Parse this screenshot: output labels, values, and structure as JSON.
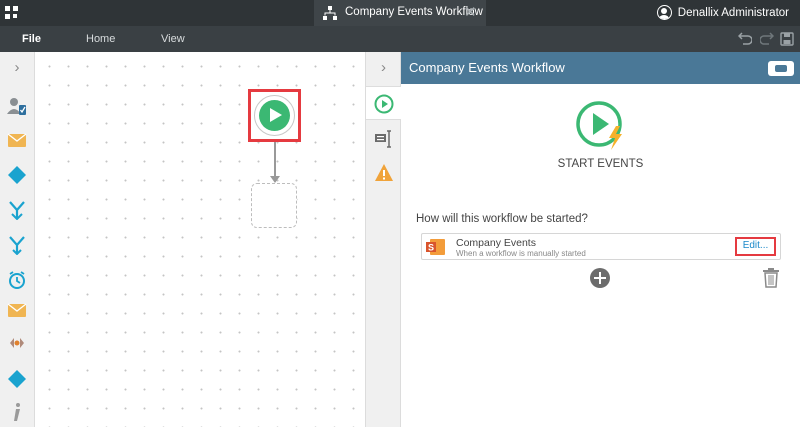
{
  "titlebar": {
    "apps_icon": "app-grid-icon",
    "tab_label": "Company Events Workflow",
    "user_name": "Denallix Administrator"
  },
  "ribbon": {
    "file": "File",
    "home": "Home",
    "view": "View"
  },
  "panel": {
    "title": "Company Events Workflow",
    "hero_label": "START EVENTS",
    "question": "How will this workflow be started?",
    "event": {
      "title": "Company Events",
      "subtitle": "When a workflow is manually started",
      "edit_label": "Edit..."
    }
  },
  "colors": {
    "accent": "#4a7897",
    "start_green": "#3bb873",
    "highlight_red": "#e53a40",
    "link_blue": "#1a88c9"
  }
}
